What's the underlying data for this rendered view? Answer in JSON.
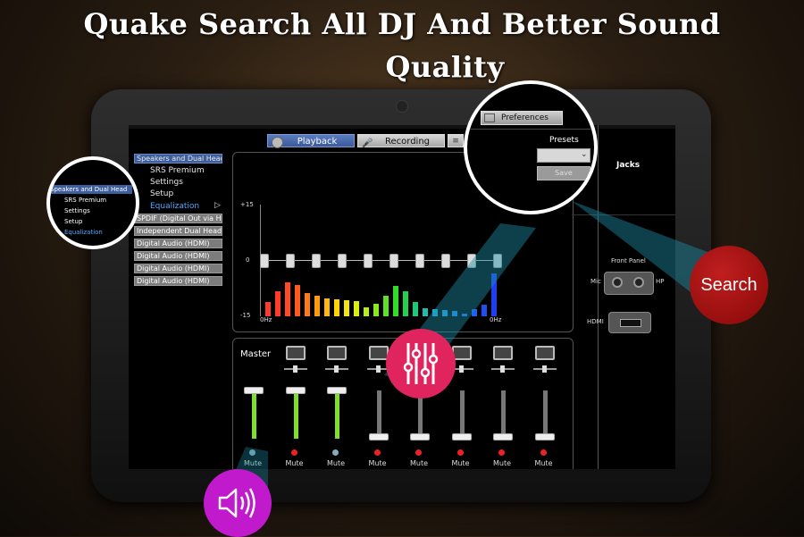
{
  "headline": {
    "line1": "Quake Search All DJ And Better Sound",
    "line2": "Quality"
  },
  "colors": {
    "accent_blue": "#3e5f9e",
    "search_badge": "#9c1010",
    "eq_badge": "#e0245e",
    "volume_badge": "#c11acd",
    "slider_green": "#7ee02a"
  },
  "tabs": {
    "playback": "Playback",
    "recording": "Recording",
    "preferences": "Preferences"
  },
  "device_tree": {
    "selected": "Speakers and Dual Head",
    "sub_items": [
      "SRS Premium",
      "Settings",
      "Setup",
      "Equalization"
    ],
    "devices": [
      "SPDIF (Digital Out via HP",
      "Independent Dual Headp",
      "Digital Audio (HDMI)",
      "Digital Audio (HDMI)",
      "Digital Audio (HDMI)",
      "Digital Audio (HDMI)"
    ]
  },
  "zoom_left": {
    "items": [
      "Speakers and Dual Head",
      "SRS Premium",
      "Settings",
      "Setup",
      "Equalization"
    ]
  },
  "presets": {
    "label": "Presets",
    "selected": "",
    "save_label": "Save"
  },
  "eq": {
    "axis": {
      "top": "+15",
      "mid": "0",
      "bottom": "-15",
      "x_left": "0Hz",
      "x_right": "0Hz"
    },
    "band_handles": [
      0,
      0,
      0,
      0,
      0,
      0,
      0,
      0,
      0,
      0
    ],
    "spectrum": [
      {
        "v": 0.32,
        "c": "#ff3b2a"
      },
      {
        "v": 0.55,
        "c": "#ff3b2a"
      },
      {
        "v": 0.75,
        "c": "#ff4a24"
      },
      {
        "v": 0.7,
        "c": "#ff5a1e"
      },
      {
        "v": 0.52,
        "c": "#ff7a14"
      },
      {
        "v": 0.45,
        "c": "#ff9a10"
      },
      {
        "v": 0.4,
        "c": "#ffb80c"
      },
      {
        "v": 0.38,
        "c": "#ffd20a"
      },
      {
        "v": 0.36,
        "c": "#f2e60c"
      },
      {
        "v": 0.34,
        "c": "#dcee10"
      },
      {
        "v": 0.2,
        "c": "#b8ee18"
      },
      {
        "v": 0.28,
        "c": "#8ce81e"
      },
      {
        "v": 0.45,
        "c": "#5ee024"
      },
      {
        "v": 0.68,
        "c": "#34da2a"
      },
      {
        "v": 0.56,
        "c": "#22d24a"
      },
      {
        "v": 0.32,
        "c": "#1ec878"
      },
      {
        "v": 0.18,
        "c": "#1ebcae"
      },
      {
        "v": 0.16,
        "c": "#1eb0d6"
      },
      {
        "v": 0.14,
        "c": "#1e9ee8"
      },
      {
        "v": 0.12,
        "c": "#1e8aee"
      },
      {
        "v": 0.06,
        "c": "#1e74f0"
      },
      {
        "v": 0.15,
        "c": "#1e60f0"
      },
      {
        "v": 0.26,
        "c": "#1e50f0"
      },
      {
        "v": 0.95,
        "c": "#2040f0"
      }
    ]
  },
  "mixer": {
    "master_label": "Master",
    "channels": [
      {
        "icon": "master-icon",
        "level": 1.0,
        "mute": "Mute",
        "muted": false,
        "active": true
      },
      {
        "icon": "laptop-icon",
        "level": 1.0,
        "mute": "Mute",
        "muted": true,
        "active": true
      },
      {
        "icon": "device-box-icon",
        "level": 1.0,
        "mute": "Mute",
        "muted": false,
        "active": true
      },
      {
        "icon": "headphones-icon",
        "level": 0.0,
        "mute": "Mute",
        "muted": true,
        "active": false
      },
      {
        "icon": "monitor-icon",
        "level": 0.0,
        "mute": "Mute",
        "muted": true,
        "active": false
      },
      {
        "icon": "monitor-icon",
        "level": 0.0,
        "mute": "Mute",
        "muted": true,
        "active": false
      },
      {
        "icon": "monitor-icon",
        "level": 0.0,
        "mute": "Mute",
        "muted": true,
        "active": false
      },
      {
        "icon": "monitor-icon",
        "level": 0.0,
        "mute": "Mute",
        "muted": true,
        "active": false
      }
    ]
  },
  "jacks": {
    "title": "Jacks",
    "front_panel": "Front Panel",
    "mic": "Mic",
    "hp": "HP",
    "hdmi": "HDMI"
  },
  "badges": {
    "search": "Search"
  }
}
